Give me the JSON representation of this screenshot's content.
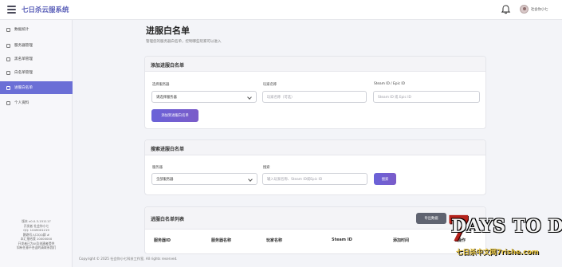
{
  "topbar": {
    "brand": "七日杀云服系统",
    "username": "社会你小七"
  },
  "sidebar": {
    "items": [
      {
        "label": "数据统计",
        "icon": "chart-icon"
      },
      {
        "label": "服务器管理",
        "icon": "server-icon"
      },
      {
        "label": "黑名单管理",
        "icon": "blacklist-icon"
      },
      {
        "label": "白名单管理",
        "icon": "whitelist-icon"
      },
      {
        "label": "进服白名单",
        "icon": "list-icon"
      },
      {
        "label": "个人资料",
        "icon": "user-icon"
      }
    ],
    "active_index": 4,
    "footer_lines": [
      "版本 v0.0.3-151117",
      "开发者 社会你小七",
      "QQ: 1049001219",
      "鹦鹉号入口QQ群 #",
      "本汇报给我 10000000",
      "开发者已为UI及创建者提供",
      "如有任意不合适的请联系我们"
    ]
  },
  "page": {
    "title": "进服白名单",
    "subtitle": "管理您的服务器白名单，控制哪些玩家可以进入"
  },
  "add_card": {
    "title": "添加进服白名单",
    "server_label": "选择服务器",
    "server_value": "请选择服务器",
    "player_label": "玩家名称",
    "player_placeholder": "玩家名称（可选）",
    "steam_label": "Steam ID / Epic ID",
    "steam_placeholder": "Steam ID 或 Epic ID",
    "submit_label": "添加到进服白名单"
  },
  "search_card": {
    "title": "搜索进服白名单",
    "server_label": "服务器",
    "server_value": "全部服务器",
    "search_label": "搜索",
    "search_placeholder": "输入玩家名称、Steam ID或Epic ID",
    "search_button": "搜索"
  },
  "list_card": {
    "title": "进服白名单列表",
    "export_label": "导出数据",
    "columns": [
      "服务器ID",
      "服务器名称",
      "玩家名称",
      "Steam ID",
      "添加时间",
      "操作"
    ]
  },
  "footer": {
    "copyright": "Copyright © 2025 社会你小七科技工作室, All rights reserved."
  },
  "watermark": {
    "seven": "7",
    "title": "DAYS TO DIE",
    "subtitle": "七日杀中文网7rishe.com"
  }
}
